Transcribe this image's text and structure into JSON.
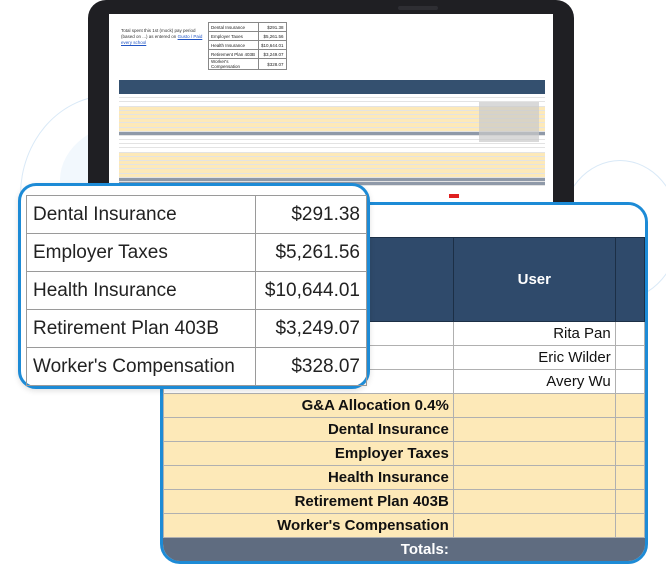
{
  "laptop_screen": {
    "note": "Total spent this 1st (mock) pay period (based on ...) as entered on",
    "note_link": "Gusto / Paid every school",
    "mini_table": [
      {
        "label": "Dental Insurance",
        "value": "$291.38"
      },
      {
        "label": "Employer Taxes",
        "value": "$5,261.56"
      },
      {
        "label": "Health Insurance",
        "value": "$10,644.01"
      },
      {
        "label": "Retirement Plan 403B",
        "value": "$3,249.07"
      },
      {
        "label": "Worker's Compensation",
        "value": "$328.07"
      }
    ]
  },
  "zoom_table": [
    {
      "label": "Dental Insurance",
      "value": "$291.38"
    },
    {
      "label": "Employer Taxes",
      "value": "$5,261.56"
    },
    {
      "label": "Health Insurance",
      "value": "$10,644.01"
    },
    {
      "label": "Retirement Plan 403B",
      "value": "$3,249.07"
    },
    {
      "label": "Worker's Compensation",
      "value": "$328.07"
    }
  ],
  "big_table": {
    "user_header": "User",
    "users": [
      "Rita Pan",
      "Eric Wilder",
      "Avery Wu"
    ],
    "allocation_label": "G&A Allocation 0.4%",
    "allocation_rows": [
      "Dental Insurance",
      "Employer Taxes",
      "Health Insurance",
      "Retirement Plan 403B",
      "Worker's Compensation"
    ],
    "totals_label": "Totals:"
  },
  "colors": {
    "accent_border": "#1d8bd6",
    "header_blue": "#2f4a6b",
    "allocation_yellow": "#fde9b8",
    "totals_gray": "#5f6c80"
  }
}
